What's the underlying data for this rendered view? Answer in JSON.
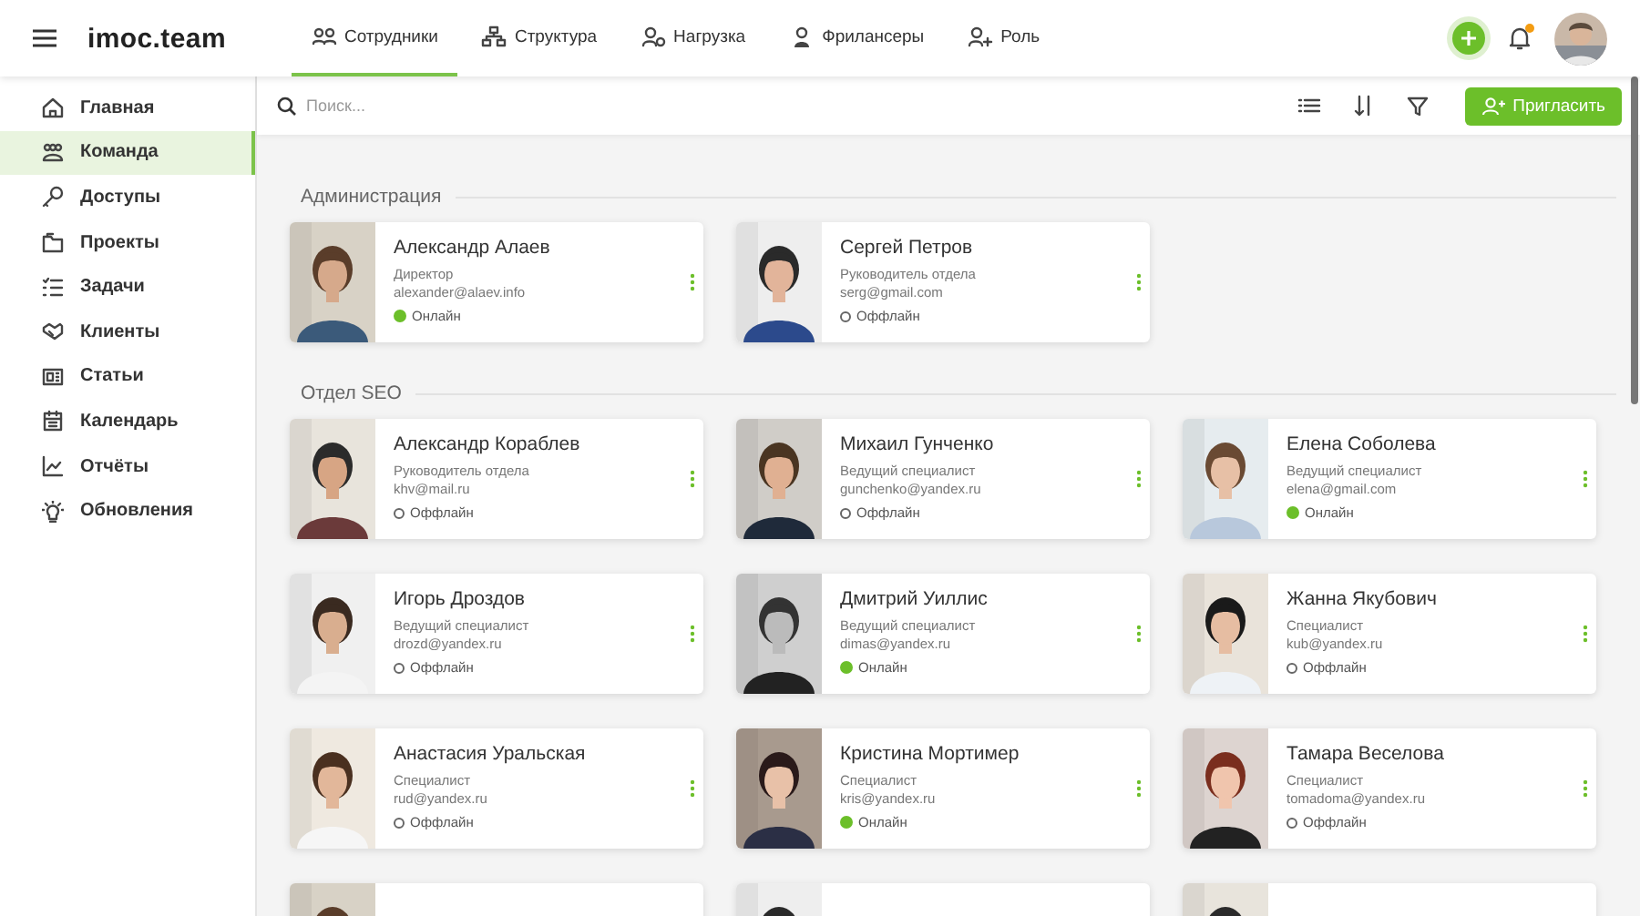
{
  "header": {
    "logo": "imoc.team",
    "tabs": [
      {
        "label": "Сотрудники",
        "selected": true
      },
      {
        "label": "Структура",
        "selected": false
      },
      {
        "label": "Нагрузка",
        "selected": false
      },
      {
        "label": "Фрилансеры",
        "selected": false
      },
      {
        "label": "Роль",
        "selected": false
      }
    ],
    "notifications": {
      "unread": true
    }
  },
  "sidebar": {
    "items": [
      {
        "label": "Главная",
        "selected": false
      },
      {
        "label": "Команда",
        "selected": true
      },
      {
        "label": "Доступы",
        "selected": false
      },
      {
        "label": "Проекты",
        "selected": false
      },
      {
        "label": "Задачи",
        "selected": false
      },
      {
        "label": "Клиенты",
        "selected": false
      },
      {
        "label": "Статьи",
        "selected": false
      },
      {
        "label": "Календарь",
        "selected": false
      },
      {
        "label": "Отчёты",
        "selected": false
      },
      {
        "label": "Обновления",
        "selected": false
      }
    ]
  },
  "toolbar": {
    "search": {
      "placeholder": "Поиск..."
    },
    "invite_button": "Пригласить"
  },
  "groups": [
    {
      "title": "Администрация",
      "members": [
        {
          "photo": {
            "kind": "picture"
          },
          "name": "Александр Алаев",
          "role": "Директор",
          "email": "alexander@alaev.info",
          "online": true,
          "status": "Онлайн"
        },
        {
          "photo": {
            "kind": "picture"
          },
          "name": "Сергей Петров",
          "role": "Руководитель отдела",
          "email": "serg@gmail.com",
          "online": false,
          "status": "Оффлайн"
        }
      ]
    },
    {
      "title": "Отдел SEO",
      "members": [
        {
          "photo": {
            "kind": "picture"
          },
          "name": "Александр Кораблев",
          "role": "Руководитель отдела",
          "email": "khv@mail.ru",
          "online": false,
          "status": "Оффлайн"
        },
        {
          "photo": {
            "kind": "picture"
          },
          "name": "Михаил Гунченко",
          "role": "Ведущий специалист",
          "email": "gunchenko@yandex.ru",
          "online": false,
          "status": "Оффлайн"
        },
        {
          "photo": {
            "kind": "picture"
          },
          "name": "Елена Соболева",
          "role": "Ведущий специалист",
          "email": "elena@gmail.com",
          "online": true,
          "status": "Онлайн"
        },
        {
          "photo": {
            "kind": "picture"
          },
          "name": "Игорь Дроздов",
          "role": "Ведущий специалист",
          "email": "drozd@yandex.ru",
          "online": false,
          "status": "Оффлайн"
        },
        {
          "photo": {
            "kind": "picture"
          },
          "name": "Дмитрий Уиллис",
          "role": "Ведущий специалист",
          "email": "dimas@yandex.ru",
          "online": true,
          "status": "Онлайн"
        },
        {
          "photo": {
            "kind": "picture"
          },
          "name": "Жанна Якубович",
          "role": "Специалист",
          "email": "kub@yandex.ru",
          "online": false,
          "status": "Оффлайн"
        },
        {
          "photo": {
            "kind": "picture"
          },
          "name": "Анастасия Уральская",
          "role": "Специалист",
          "email": "rud@yandex.ru",
          "online": false,
          "status": "Оффлайн"
        },
        {
          "photo": {
            "kind": "picture"
          },
          "name": "Кристина Мортимер",
          "role": "Специалист",
          "email": "kris@yandex.ru",
          "online": true,
          "status": "Онлайн"
        },
        {
          "photo": {
            "kind": "picture"
          },
          "name": "Тамара Веселова",
          "role": "Специалист",
          "email": "tomadoma@yandex.ru",
          "online": false,
          "status": "Оффлайн"
        },
        {
          "photo": {
            "kind": "picture"
          }
        },
        {
          "photo": {
            "kind": "picture"
          }
        },
        {
          "photo": {
            "kind": "picture"
          }
        }
      ]
    }
  ]
}
